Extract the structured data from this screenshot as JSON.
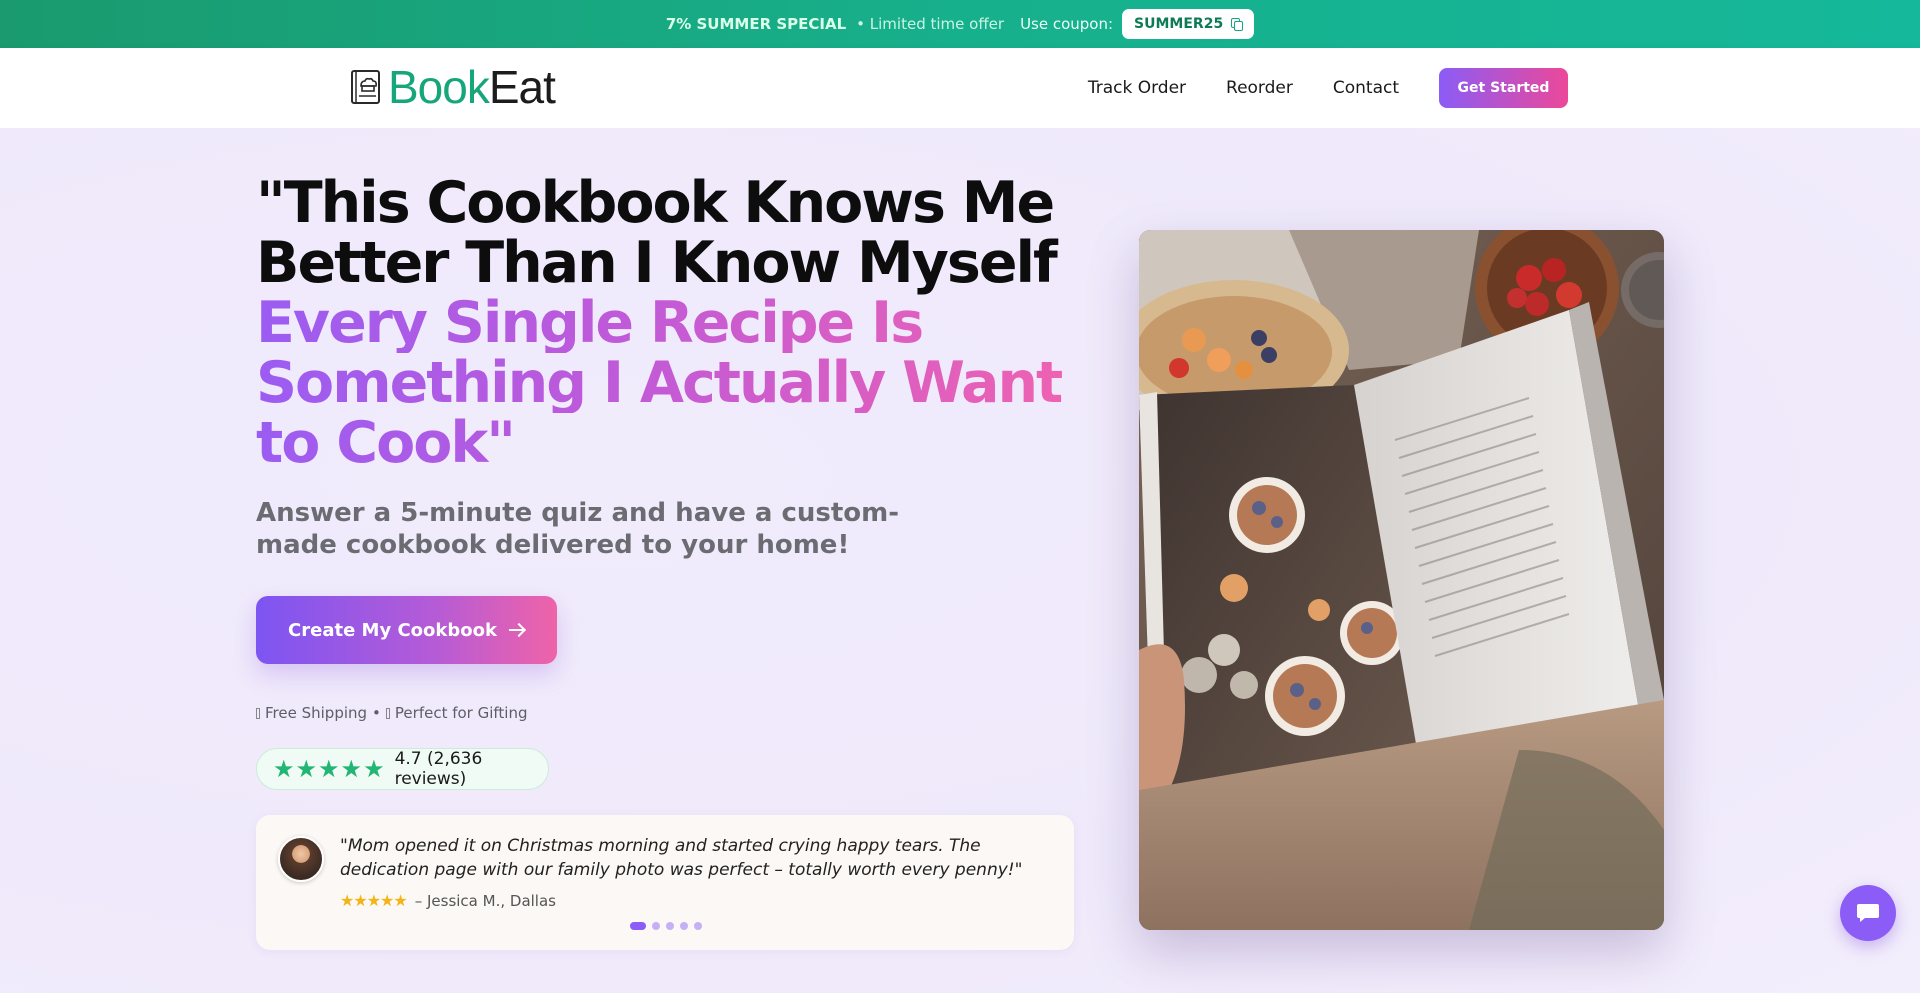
{
  "promo": {
    "headline": "7% SUMMER SPECIAL",
    "offer": "• Limited time offer",
    "coupon_label": "Use coupon:",
    "coupon_code": "SUMMER25",
    "copy_icon": "copy-icon"
  },
  "header": {
    "logo_part1": "Book",
    "logo_part2": "Eat",
    "logo_icon": "cookbook-chef-hat-icon",
    "nav": [
      "Track Order",
      "Reorder",
      "Contact"
    ],
    "cta": "Get Started"
  },
  "hero": {
    "headline_line1": "\"This Cookbook Knows Me",
    "headline_line2": "Better Than I Know Myself",
    "headline_line3": "Every Single Recipe Is",
    "headline_line4": "Something I Actually Want",
    "headline_line5": "to Cook\"",
    "subheadline": "Answer a 5-minute quiz and have a custom-made cookbook delivered to your home!",
    "cta": "Create My Cookbook",
    "cta_icon": "arrow-right-icon",
    "perk1": "Free Shipping",
    "perk_separator": "•",
    "perk2": "Perfect for Gifting",
    "rating_text": "4.7 (2,636 reviews)",
    "rating_stars": 5
  },
  "testimonial": {
    "quote": "\"Mom opened it on Christmas morning and started crying happy tears. The dedication page with our family photo was perfect – totally worth every penny!\"",
    "stars": "★★★★★",
    "author": "– Jessica M., Dallas",
    "slide_count": 5,
    "active_slide": 1
  },
  "chat": {
    "icon": "chat-bubble-icon"
  },
  "colors": {
    "promo_green": "#17a57c",
    "accent_purple": "#8b5cf6",
    "accent_pink": "#ec4899",
    "rating_green": "#22b573",
    "review_star": "#f3b415"
  }
}
